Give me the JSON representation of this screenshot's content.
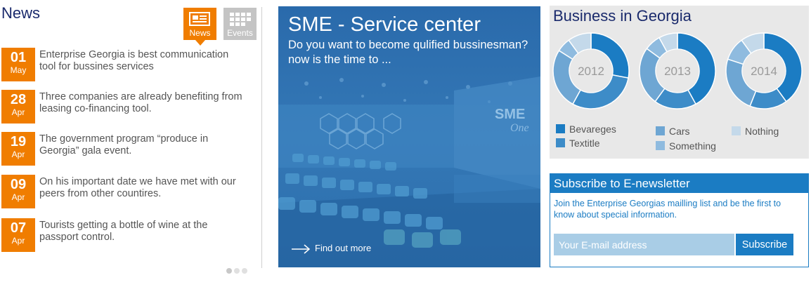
{
  "news": {
    "title": "News",
    "tabs": [
      {
        "label": "News",
        "icon": "news-icon",
        "active": true
      },
      {
        "label": "Events",
        "icon": "events-grid-icon",
        "active": false
      }
    ],
    "items": [
      {
        "day": "01",
        "month": "May",
        "text": "Enterprise Georgia is best communication tool for bussines services"
      },
      {
        "day": "28",
        "month": "Apr",
        "text": "Three companies are already benefiting from leasing co-financing tool."
      },
      {
        "day": "19",
        "month": "Apr",
        "text": "The government program “produce in Georgia” gala event."
      },
      {
        "day": "09",
        "month": "Apr",
        "text": "On his important date we have met with our peers from other countires."
      },
      {
        "day": "07",
        "month": "Apr",
        "text": "Tourists getting a bottle of wine at the passport control."
      }
    ],
    "pager": {
      "pages": 3,
      "active": 1
    }
  },
  "sme": {
    "title": "SME - Service center",
    "subtitle": "Do you want to become qulified bussinesman? now is the time to ...",
    "link": "Find out more"
  },
  "business": {
    "title": "Business in Georgia",
    "colors": {
      "Bevareges": "#1b7cc3",
      "Textitle": "#3d8cc8",
      "Cars": "#6ea6d3",
      "Something": "#8fbbdf",
      "Nothing": "#c4d9ea"
    },
    "years": [
      "2012",
      "2013",
      "2014"
    ],
    "legend": [
      "Bevareges",
      "Textitle",
      "Cars",
      "Something",
      "Nothing"
    ]
  },
  "chart_data": {
    "type": "pie",
    "title": "Business in Georgia",
    "categories": [
      "Bevareges",
      "Textitle",
      "Cars",
      "Something",
      "Nothing"
    ],
    "series": [
      {
        "name": "2012",
        "values": [
          28,
          30,
          26,
          6,
          10
        ]
      },
      {
        "name": "2013",
        "values": [
          42,
          18,
          25,
          7,
          8
        ]
      },
      {
        "name": "2014",
        "values": [
          40,
          16,
          24,
          10,
          10
        ]
      }
    ]
  },
  "subscribe": {
    "title": "Subscribe to E-newsletter",
    "description": "Join the Enterprise Georgias mailling list and be the first to know about special information.",
    "placeholder": "Your E-mail address",
    "button": "Subscribe"
  }
}
